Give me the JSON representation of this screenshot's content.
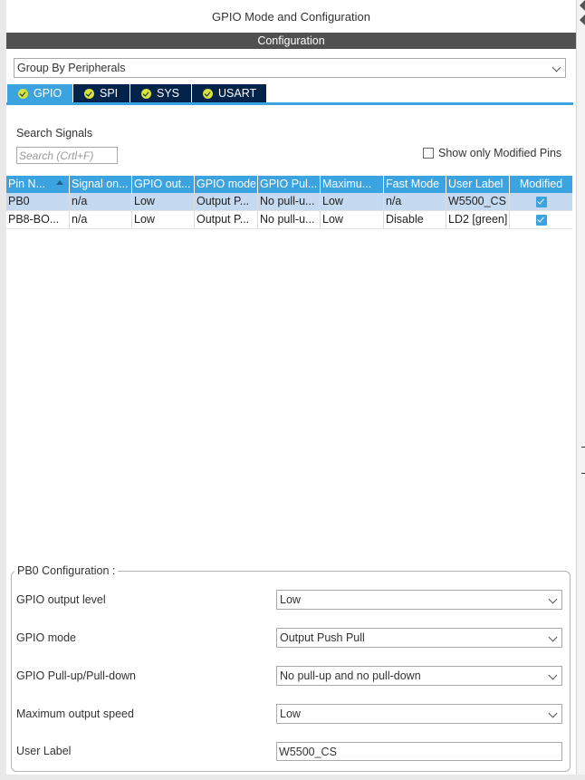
{
  "header": {
    "title": "GPIO Mode and Configuration"
  },
  "config_bar": {
    "title": "Configuration"
  },
  "group_select": {
    "value": "Group By Peripherals"
  },
  "tabs": [
    {
      "label": "GPIO",
      "active": true
    },
    {
      "label": "SPI",
      "active": false
    },
    {
      "label": "SYS",
      "active": false
    },
    {
      "label": "USART",
      "active": false
    }
  ],
  "search": {
    "label": "Search Signals",
    "placeholder": "Search (Crtl+F)"
  },
  "show_modified": {
    "label": "Show only Modified Pins",
    "checked": false
  },
  "table": {
    "columns": [
      "Pin N...",
      "Signal on...",
      "GPIO out...",
      "GPIO mode",
      "GPIO Pul...",
      "Maximu...",
      "Fast Mode",
      "User Label",
      "Modified"
    ],
    "rows": [
      {
        "pin": "PB0",
        "signal": "n/a",
        "output": "Low",
        "mode": "Output P...",
        "pull": "No pull-u...",
        "speed": "Low",
        "fast": "n/a",
        "label": "W5500_CS",
        "modified": true,
        "selected": true
      },
      {
        "pin": "PB8-BO...",
        "signal": "n/a",
        "output": "Low",
        "mode": "Output P...",
        "pull": "No pull-u...",
        "speed": "Low",
        "fast": "Disable",
        "label": "LD2 [green]",
        "modified": true,
        "selected": false
      }
    ]
  },
  "pin_config": {
    "title": "PB0 Configuration :",
    "fields": [
      {
        "label": "GPIO output level",
        "value": "Low"
      },
      {
        "label": "GPIO mode",
        "value": "Output Push Pull"
      },
      {
        "label": "GPIO Pull-up/Pull-down",
        "value": "No pull-up and no pull-down"
      },
      {
        "label": "Maximum output speed",
        "value": "Low"
      },
      {
        "label": "User Label",
        "value": "W5500_CS"
      }
    ]
  },
  "colors": {
    "accent": "#3aa3e0",
    "tab_inactive": "#03234b",
    "header_bar": "#505050",
    "selected_row": "#c5daf0"
  }
}
